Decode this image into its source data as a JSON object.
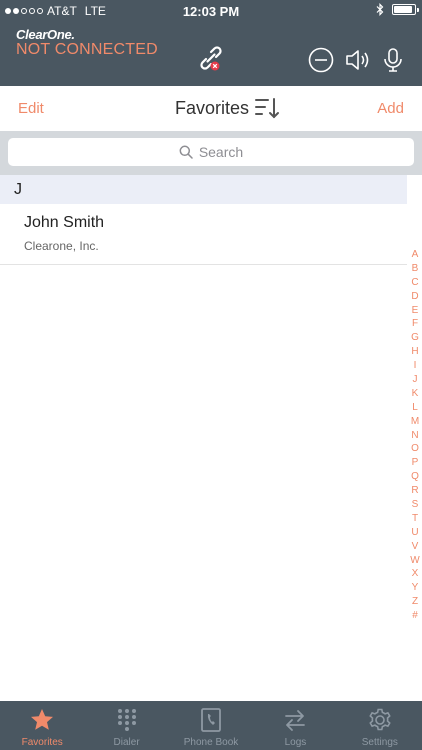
{
  "status_bar": {
    "carrier": "AT&T",
    "network": "LTE",
    "time": "12:03 PM",
    "signal_bars_filled": 2,
    "signal_bars_total": 5,
    "battery_level": 0.9
  },
  "header": {
    "brand": "ClearOne.",
    "connection_status": "NOT CONNECTED",
    "status_color": "#f08a6a",
    "background_color": "#4a5761"
  },
  "navbar": {
    "edit_label": "Edit",
    "title": "Favorites",
    "add_label": "Add"
  },
  "search": {
    "placeholder": "Search"
  },
  "favorites": {
    "sections": [
      {
        "letter": "J",
        "contacts": [
          {
            "name": "John Smith",
            "company": "Clearone, Inc."
          }
        ]
      }
    ]
  },
  "index_letters": [
    "A",
    "B",
    "C",
    "D",
    "E",
    "F",
    "G",
    "H",
    "I",
    "J",
    "K",
    "L",
    "M",
    "N",
    "O",
    "P",
    "Q",
    "R",
    "S",
    "T",
    "U",
    "V",
    "W",
    "X",
    "Y",
    "Z",
    "#"
  ],
  "tabs": [
    {
      "label": "Favorites",
      "icon": "star-icon",
      "active": true
    },
    {
      "label": "Dialer",
      "icon": "keypad-icon",
      "active": false
    },
    {
      "label": "Phone Book",
      "icon": "phone-book-icon",
      "active": false
    },
    {
      "label": "Logs",
      "icon": "swap-arrows-icon",
      "active": false
    },
    {
      "label": "Settings",
      "icon": "gear-icon",
      "active": false
    }
  ],
  "accent_color": "#f08a6a"
}
